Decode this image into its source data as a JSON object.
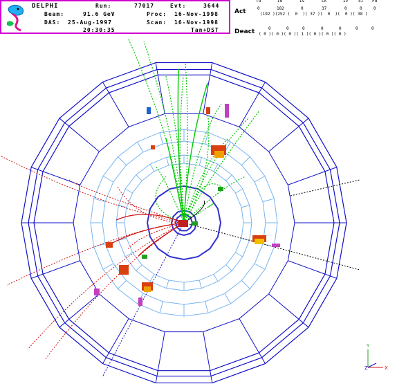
{
  "header": {
    "experiment": "DELPHI",
    "run_label": "Run:",
    "run_value": "77017",
    "evt_label": "Evt:",
    "evt_value": "3644",
    "beam_label": "Beam:",
    "beam_value": "91.6 GeV",
    "proc_label": "Proc:",
    "proc_value": "16-Nov-1998",
    "das_label": "DAS:",
    "das_value": "25-Aug-1997",
    "scan_label": "Scan:",
    "scan_value": "16-Nov-1998",
    "time_value": "20:30:35",
    "source_value": "Tan+DST"
  },
  "stats": {
    "columns": [
      "Td",
      "Id",
      "Is",
      "Lk",
      "Iv",
      "Si",
      "Fd"
    ],
    "act_label": "Act",
    "act_top": [
      "0",
      "182",
      "0",
      "37",
      "0",
      "0",
      "0"
    ],
    "act_bottom": [
      "192",
      "252",
      "0",
      "37",
      "0",
      "0",
      "38"
    ],
    "deact_label": "Deact",
    "deact_top": [
      "0",
      "0",
      "0",
      "0",
      "0",
      "0",
      "0"
    ],
    "deact_bottom": [
      "0",
      "0",
      "0",
      "1",
      "0",
      "0",
      "0"
    ]
  },
  "axes": {
    "y_label": "Y",
    "z_label": "Z",
    "x_label": "X"
  },
  "colors": {
    "frame": "#d000d0",
    "outer_detector": "#1010c8",
    "inner_detector": "#78b4f0",
    "vertex": "#3030d0",
    "tracks_green": "#00c800",
    "tracks_red": "#d01010",
    "tracks_black": "#000000",
    "tracks_blue": "#1010c8"
  }
}
